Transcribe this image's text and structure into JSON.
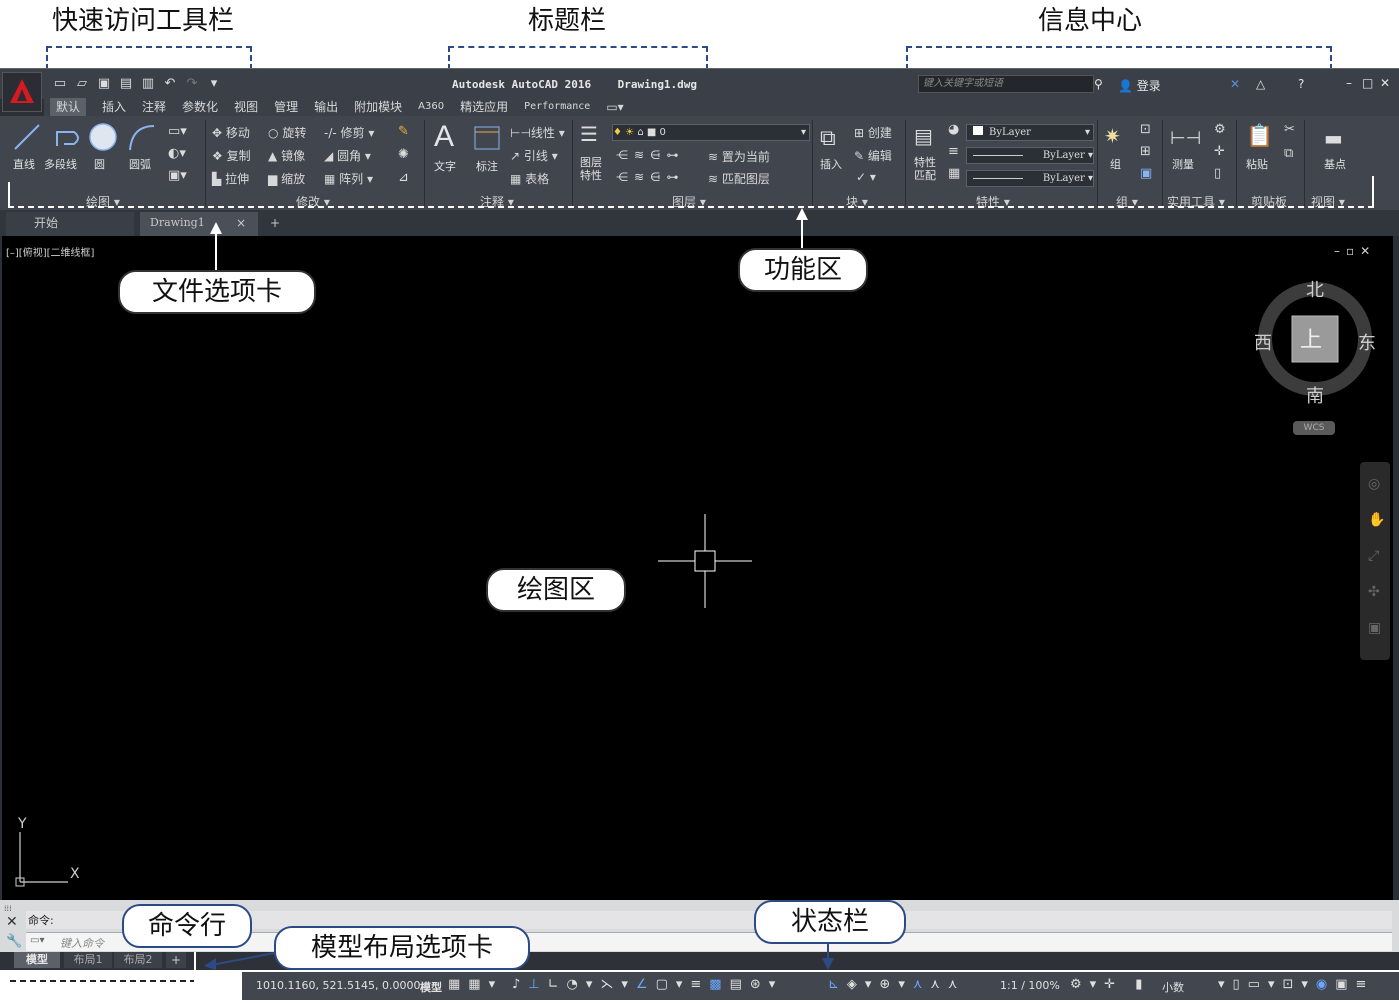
{
  "callouts": {
    "quick_access_toolbar": "快速访问工具栏",
    "title_bar": "标题栏",
    "info_center": "信息中心",
    "file_tabs": "文件选项卡",
    "ribbon": "功能区",
    "drawing_area": "绘图区",
    "command_line": "命令行",
    "layout_tabs": "模型布局选项卡",
    "status_bar": "状态栏"
  },
  "titlebar": {
    "app_name": "Autodesk AutoCAD 2016",
    "file_name": "Drawing1.dwg",
    "search_placeholder": "键入关键字或短语",
    "login": "登录",
    "window_min": "–",
    "window_max": "□",
    "window_close": "✕"
  },
  "ribbon_tabs": [
    "默认",
    "插入",
    "注释",
    "参数化",
    "视图",
    "管理",
    "输出",
    "附加模块",
    "A360",
    "精选应用",
    "Performance"
  ],
  "ribbon": {
    "draw": {
      "title": "绘图",
      "line": "直线",
      "polyline": "多段线",
      "circle": "圆",
      "arc": "圆弧"
    },
    "modify": {
      "title": "修改",
      "move": "移动",
      "rotate": "旋转",
      "trim": "修剪",
      "copy": "复制",
      "mirror": "镜像",
      "fillet": "圆角",
      "stretch": "拉伸",
      "scale": "缩放",
      "array": "阵列"
    },
    "annotation": {
      "title": "注释",
      "text": "文字",
      "dimension": "标注",
      "linear": "线性",
      "leader": "引线",
      "table": "表格"
    },
    "layers": {
      "title": "图层",
      "layer_props": "图层\n特性",
      "layer_value": "0",
      "set_current": "置为当前",
      "match_layer": "匹配图层"
    },
    "block": {
      "title": "块",
      "insert": "插入",
      "create": "创建",
      "edit": "编辑"
    },
    "properties": {
      "title": "特性",
      "match": "特性\n匹配",
      "color": "ByLayer",
      "linetype": "ByLayer",
      "lineweight": "ByLayer"
    },
    "groups": {
      "title": "组",
      "group": "组"
    },
    "utilities": {
      "title": "实用工具",
      "measure": "测量"
    },
    "clipboard": {
      "title": "剪贴板",
      "paste": "粘贴"
    },
    "view": {
      "title": "视图",
      "base": "基点"
    }
  },
  "file_tabs": {
    "start": "开始",
    "drawing": "Drawing1",
    "close": "×",
    "add": "+"
  },
  "drawing": {
    "viewport_label": "[–][俯视][二维线框]",
    "viewcube": {
      "north": "北",
      "south": "南",
      "east": "东",
      "west": "西",
      "face": "上",
      "wcs": "WCS"
    },
    "ucs": {
      "x": "X",
      "y": "Y"
    }
  },
  "command": {
    "history": "命令:",
    "placeholder": "键入命令"
  },
  "layout_tabs": {
    "model": "模型",
    "layout1": "布局1",
    "layout2": "布局2",
    "add": "+"
  },
  "status": {
    "coords": "1010.1160, 521.5145, 0.0000",
    "model": "模型",
    "scale": "1:1 / 100%",
    "units": "小数"
  }
}
